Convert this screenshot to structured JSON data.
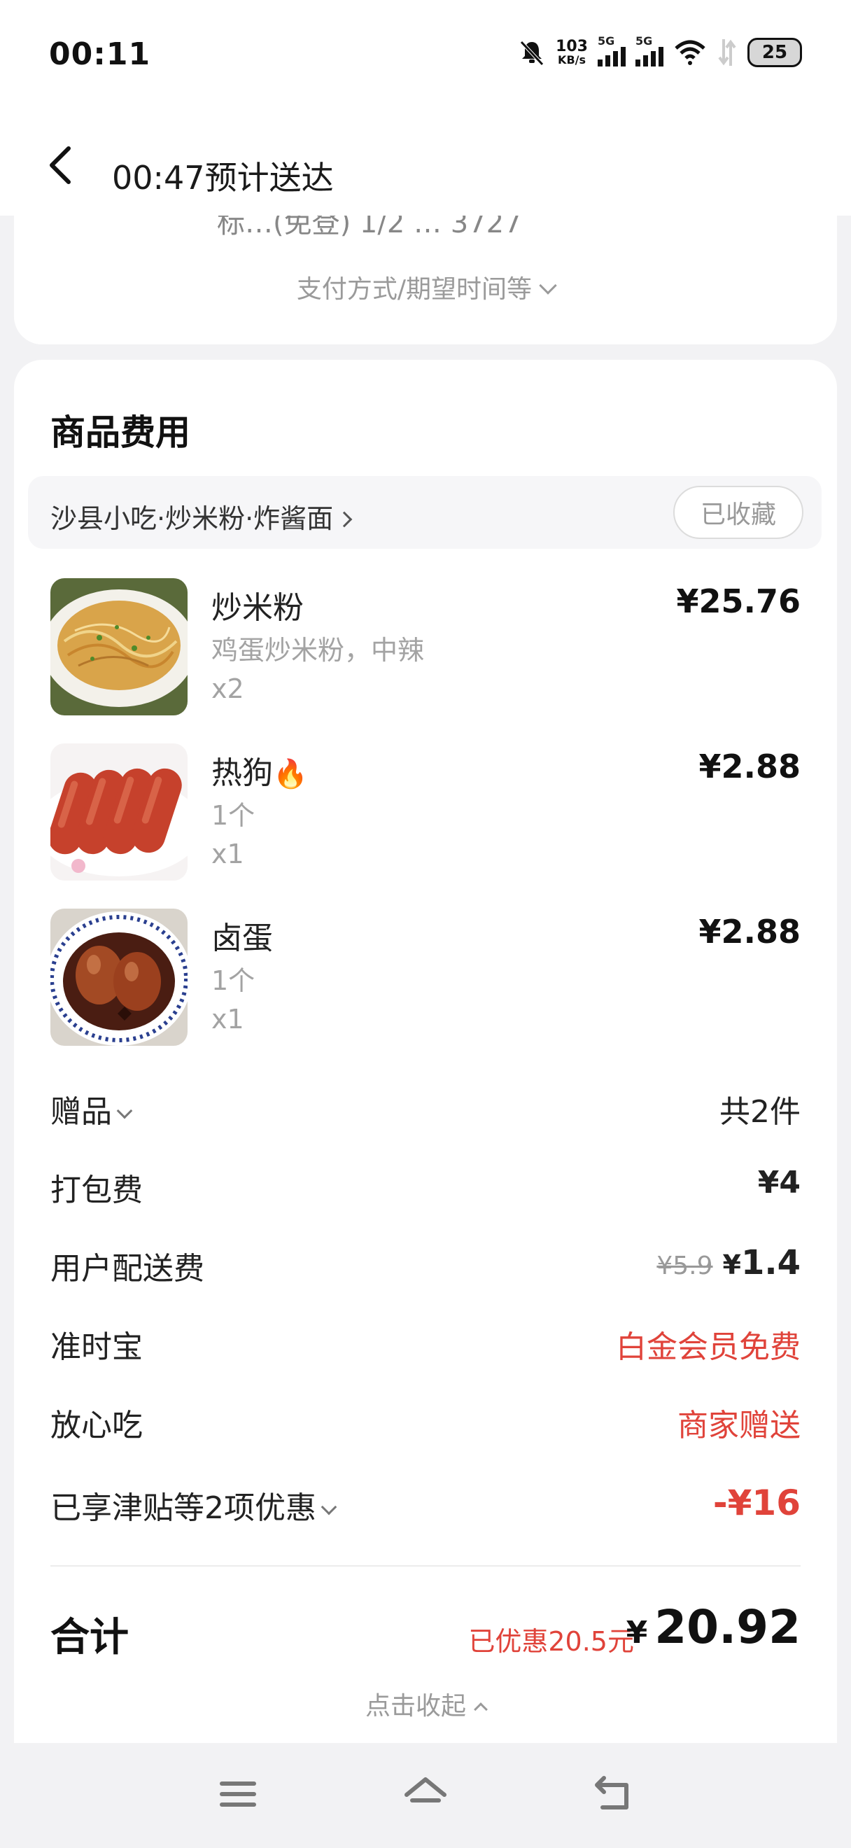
{
  "status_bar": {
    "time": "00:11",
    "net_speed_value": "103",
    "net_speed_unit": "KB/s",
    "sig1_label": "5G",
    "sig2_label": "5G",
    "battery": "25"
  },
  "nav": {
    "title": "00:47预计送达",
    "back_icon": "back-arrow-icon"
  },
  "top_card": {
    "ghost_text": "标…(免登) 1/2  …  3727",
    "pay_toggle": "支付方式/期望时间等"
  },
  "fees_card": {
    "title": "商品费用",
    "shop_name": "沙县小吃·炒米粉·炸酱面",
    "fav_label": "已收藏",
    "items": [
      {
        "name": "炒米粉",
        "sub": "鸡蛋炒米粉，中辣",
        "qty": "x2",
        "price": "¥25.76",
        "icon": ""
      },
      {
        "name": "热狗",
        "sub": "1个",
        "qty": "x1",
        "price": "¥2.88",
        "icon": "🔥"
      },
      {
        "name": "卤蛋",
        "sub": "1个",
        "qty": "x1",
        "price": "¥2.88",
        "icon": ""
      }
    ],
    "gift_label": "赠品",
    "gift_value": "共2件",
    "packing_label": "打包费",
    "packing_value": "¥4",
    "delivery_label": "用户配送费",
    "delivery_old": "¥5.9",
    "delivery_cur": "¥",
    "delivery_value": "1.4",
    "ontime_label": "准时宝",
    "ontime_value": "白金会员免费",
    "safe_label": "放心吃",
    "safe_value": "商家赠送",
    "discount_label": "已享津贴等2项优惠",
    "discount_value": "-¥16",
    "total_label": "合计",
    "saved_text": "已优惠20.5元",
    "total_currency": "¥",
    "total_value": "20.92",
    "collapse_label": "点击收起"
  },
  "colors": {
    "accent_red": "#e0433a",
    "bg": "#f2f2f4",
    "card": "#ffffff"
  }
}
